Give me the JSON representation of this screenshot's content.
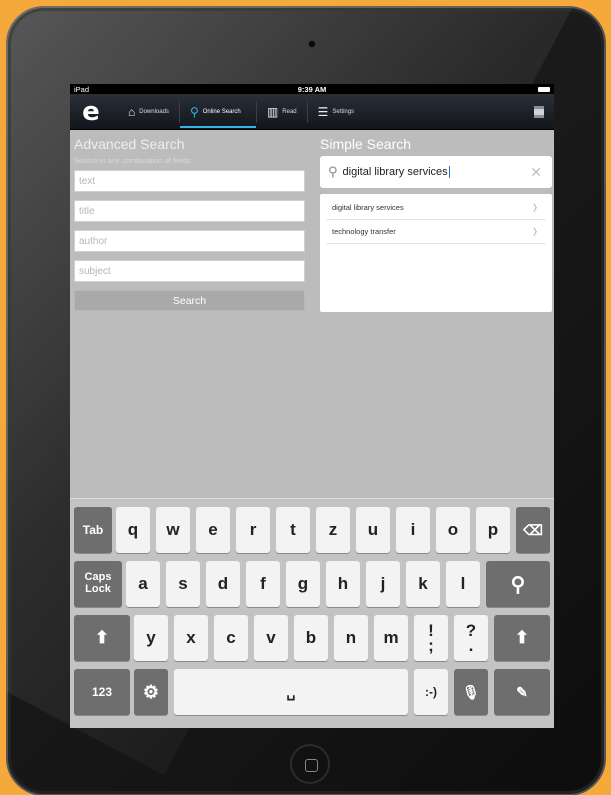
{
  "status": {
    "carrier": "iPad",
    "time": "9:39 AM"
  },
  "nav": {
    "logo": "e",
    "tabs": [
      {
        "label": "Downloads",
        "icon": "home-icon"
      },
      {
        "label": "Online Search",
        "icon": "search-icon",
        "active": true
      },
      {
        "label": "Read",
        "icon": "book-icon"
      },
      {
        "label": "Settings",
        "icon": "sliders-icon"
      }
    ]
  },
  "advanced": {
    "title": "Advanced Search",
    "hint": "Search in any combination of fields:",
    "fields": [
      "text",
      "title",
      "author",
      "subject"
    ],
    "button": "Search"
  },
  "simple": {
    "title": "Simple Search",
    "query": "digital library services",
    "suggestions": [
      "digital library services",
      "technology transfer"
    ]
  },
  "keyboard": {
    "row1": [
      "Tab",
      "q",
      "w",
      "e",
      "r",
      "t",
      "z",
      "u",
      "i",
      "o",
      "p"
    ],
    "row2_caps": "Caps Lock",
    "row2": [
      "a",
      "s",
      "d",
      "f",
      "g",
      "h",
      "j",
      "k",
      "l"
    ],
    "row3": [
      "y",
      "x",
      "c",
      "v",
      "b",
      "n",
      "m",
      "!",
      "?"
    ],
    "row3_punct_sub": [
      ";",
      "."
    ],
    "num_key": "123",
    "smiley": ":-)"
  },
  "colors": {
    "accent": "#33b5e5",
    "navbar": "#1a1e25",
    "frame": "#f5a93a"
  }
}
